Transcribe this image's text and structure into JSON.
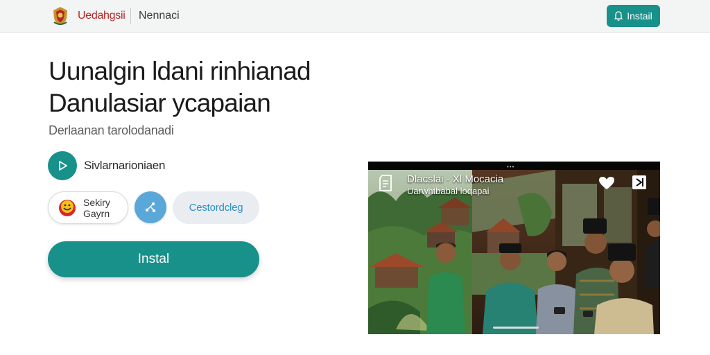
{
  "header": {
    "brand": "Uedahgsii",
    "nav_link": "Nennaci",
    "install_label": "Instail"
  },
  "hero": {
    "title_line1": "Uunalgin ldani rinhianad",
    "title_line2": "Danulasiar ycapaian",
    "subtitle": "Derlaanan tarolodanadi",
    "play_label": "Sivlarnarioniaen",
    "store_chip": {
      "line1": "Sekiry",
      "line2": "Gayrn"
    },
    "pill_label": "Cestordcleg",
    "install_label": "Instal"
  },
  "video": {
    "title": "Dlacslai · Xl Mocacia",
    "subtitle": "Uarwhtbabal loqapai",
    "dots": "•••"
  },
  "colors": {
    "accent": "#17918a",
    "brand": "#b3262a",
    "share": "#5aa7d9",
    "pill_text": "#2f8fc4"
  },
  "icons": {
    "logo": "emblem-icon",
    "header_install": "bell-icon",
    "play": "play-icon",
    "store": "smile-icon",
    "share": "share-icon",
    "video_left": "document-icon",
    "video_heart": "heart-icon",
    "video_exit": "exit-icon"
  }
}
